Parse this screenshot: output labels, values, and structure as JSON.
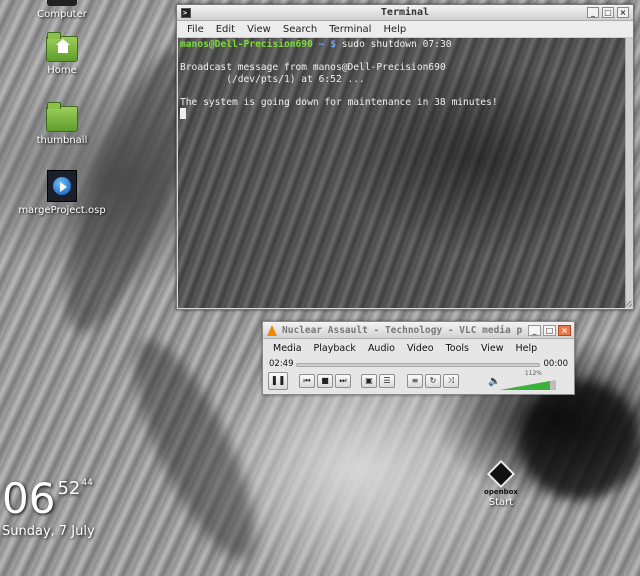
{
  "desktop": {
    "icons": [
      {
        "label": "Computer"
      },
      {
        "label": "Home"
      },
      {
        "label": "thumbnail"
      },
      {
        "label": "margeProject.osp"
      }
    ]
  },
  "clock": {
    "hours_minutes": "06",
    "minutes": "52",
    "seconds": "44",
    "date": "Sunday, 7 July"
  },
  "openbox": {
    "brand": "openbox",
    "start_label": "Start"
  },
  "terminal": {
    "title": "Terminal",
    "menu": [
      "File",
      "Edit",
      "View",
      "Search",
      "Terminal",
      "Help"
    ],
    "prompt_user": "manos@Dell-Precision690",
    "prompt_path": "~ $",
    "command": "sudo shutdown 07:30",
    "output": [
      "",
      "Broadcast message from manos@Dell-Precision690",
      "        (/dev/pts/1) at 6:52 ...",
      "",
      "The system is going down for maintenance in 38 minutes!"
    ]
  },
  "vlc": {
    "title": "Nuclear Assault - Technology - VLC media p",
    "menu": [
      "Media",
      "Playback",
      "Audio",
      "Video",
      "Tools",
      "View",
      "Help"
    ],
    "elapsed": "02:49",
    "remaining": "00:00",
    "volume_label": "112%",
    "volume_level": 1.12
  },
  "colors": {
    "prompt_user": "#7cdc3c",
    "prompt_path": "#6aa8ff",
    "vlc_cone": "#f08a00",
    "volume_fill": "#3ab23a"
  }
}
